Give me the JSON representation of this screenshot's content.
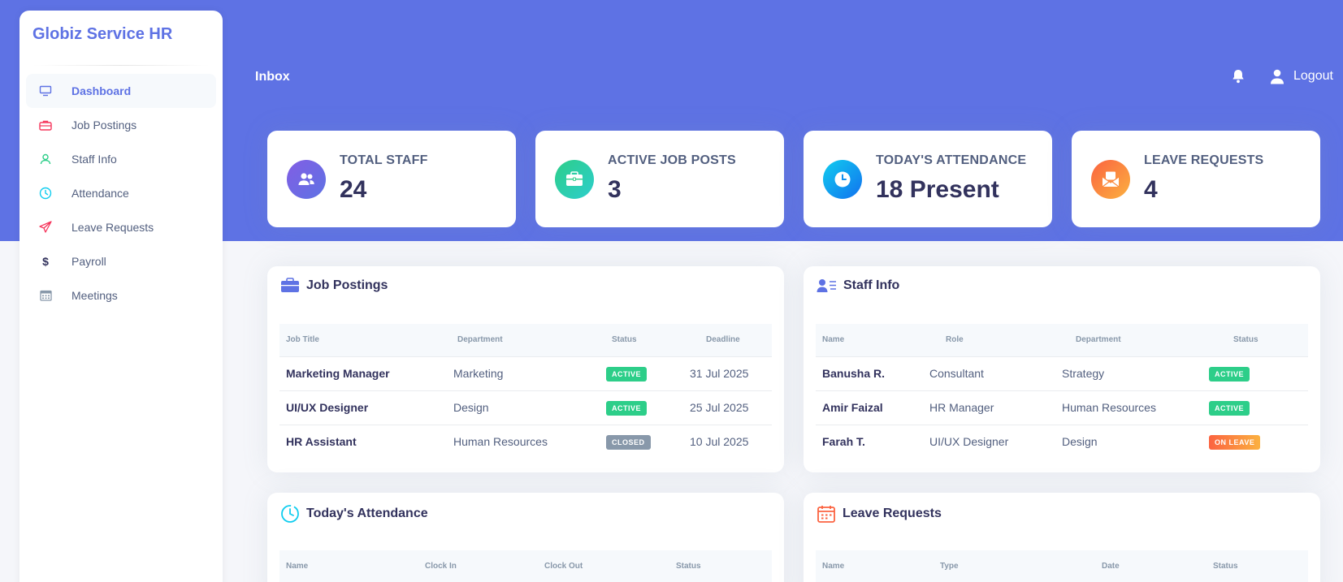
{
  "brand": "Globiz Service HR",
  "topbar": {
    "title": "Inbox",
    "logout_label": "Logout"
  },
  "sidebar": {
    "items": [
      {
        "label": "Dashboard",
        "icon": "monitor-icon",
        "active": true
      },
      {
        "label": "Job Postings",
        "icon": "briefcase-icon"
      },
      {
        "label": "Staff Info",
        "icon": "user-icon"
      },
      {
        "label": "Attendance",
        "icon": "clock-icon"
      },
      {
        "label": "Leave Requests",
        "icon": "paper-plane-icon"
      },
      {
        "label": "Payroll",
        "icon": "dollar-icon"
      },
      {
        "label": "Meetings",
        "icon": "calendar-icon"
      }
    ]
  },
  "stats": [
    {
      "label": "TOTAL STAFF",
      "value": "24",
      "icon": "users-icon",
      "color": "#825ee4"
    },
    {
      "label": "ACTIVE JOB POSTS",
      "value": "3",
      "icon": "briefcase-icon",
      "color": "#2dce89"
    },
    {
      "label": "TODAY'S ATTENDANCE",
      "value": "18 Present",
      "icon": "clock-icon",
      "color": "#11cdef"
    },
    {
      "label": "LEAVE REQUESTS",
      "value": "4",
      "icon": "envelope-icon",
      "color": "#fb6340"
    }
  ],
  "job_postings": {
    "title": "Job Postings",
    "columns": [
      "Job Title",
      "Department",
      "Status",
      "Deadline"
    ],
    "rows": [
      {
        "title": "Marketing Manager",
        "department": "Marketing",
        "status": "ACTIVE",
        "deadline": "31 Jul 2025"
      },
      {
        "title": "UI/UX Designer",
        "department": "Design",
        "status": "ACTIVE",
        "deadline": "25 Jul 2025"
      },
      {
        "title": "HR Assistant",
        "department": "Human Resources",
        "status": "CLOSED",
        "deadline": "10 Jul 2025"
      }
    ]
  },
  "staff_info": {
    "title": "Staff Info",
    "columns": [
      "Name",
      "Role",
      "Department",
      "Status"
    ],
    "rows": [
      {
        "name": "Banusha R.",
        "role": "Consultant",
        "department": "Strategy",
        "status": "ACTIVE"
      },
      {
        "name": "Amir Faizal",
        "role": "HR Manager",
        "department": "Human Resources",
        "status": "ACTIVE"
      },
      {
        "name": "Farah T.",
        "role": "UI/UX Designer",
        "department": "Design",
        "status": "ON LEAVE"
      }
    ]
  },
  "attendance": {
    "title": "Today's Attendance",
    "columns": [
      "Name",
      "Clock In",
      "Clock Out",
      "Status"
    ]
  },
  "leave_requests": {
    "title": "Leave Requests",
    "columns": [
      "Name",
      "Type",
      "Date",
      "Status"
    ]
  },
  "colors": {
    "accent": "#5e72e4",
    "active": "#2dce89",
    "closed": "#8898aa",
    "on_leave": "#fb6340"
  }
}
